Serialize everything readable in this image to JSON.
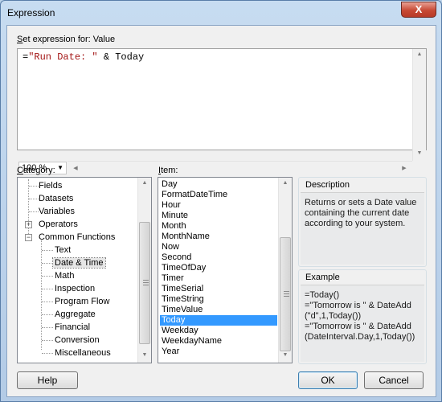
{
  "window": {
    "title": "Expression",
    "close_glyph": "X"
  },
  "expression": {
    "label_prefix": "S",
    "label_rest": "et expression for: Value",
    "code_eq": "=",
    "code_string": "\"Run Date: \"",
    "code_rest": " & Today"
  },
  "zoom": {
    "value": "100 %"
  },
  "category": {
    "label_prefix": "C",
    "label_rest": "ategory:",
    "items": [
      {
        "label": "Fields"
      },
      {
        "label": "Datasets"
      },
      {
        "label": "Variables"
      },
      {
        "label": "Operators"
      },
      {
        "label": "Common Functions"
      },
      {
        "label": "Text"
      },
      {
        "label": "Date & Time"
      },
      {
        "label": "Math"
      },
      {
        "label": "Inspection"
      },
      {
        "label": "Program Flow"
      },
      {
        "label": "Aggregate"
      },
      {
        "label": "Financial"
      },
      {
        "label": "Conversion"
      },
      {
        "label": "Miscellaneous"
      }
    ],
    "expander_plus": "+",
    "expander_minus": "−"
  },
  "item": {
    "label_prefix": "I",
    "label_rest": "tem:",
    "items": [
      "Day",
      "FormatDateTime",
      "Hour",
      "Minute",
      "Month",
      "MonthName",
      "Now",
      "Second",
      "TimeOfDay",
      "Timer",
      "TimeSerial",
      "TimeString",
      "TimeValue",
      "Today",
      "Weekday",
      "WeekdayName",
      "Year"
    ],
    "selected": "Today"
  },
  "description": {
    "title": "Description",
    "line1": "Returns or sets a Date value",
    "line2": "containing the current date",
    "line3": "according to your system."
  },
  "example": {
    "title": "Example",
    "line1": "=Today()",
    "line2": "=\"Tomorrow is \" & DateAdd",
    "line3": "(\"d\",1,Today())",
    "line4": "=\"Tomorrow is \" & DateAdd",
    "line5": "(DateInterval.Day,1,Today())"
  },
  "buttons": {
    "help": "Help",
    "ok": "OK",
    "cancel": "Cancel"
  }
}
